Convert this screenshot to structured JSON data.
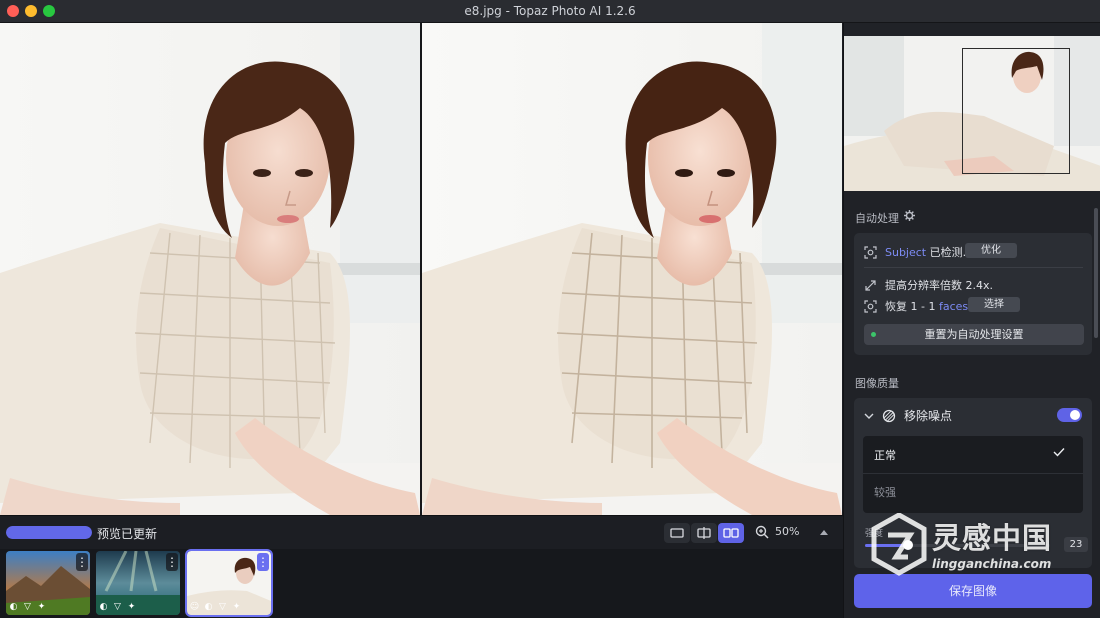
{
  "window": {
    "title": "e8.jpg - Topaz Photo AI 1.2.6"
  },
  "bottom_bar": {
    "preview_status": "预览已更新",
    "progress": 1.0,
    "zoom": "50%",
    "view_modes": [
      "single-view",
      "split-view",
      "side-by-side-view"
    ],
    "active_view": "side-by-side-view"
  },
  "filmstrip": {
    "thumbnails": [
      {
        "name": "mountain-landscape",
        "selected": false
      },
      {
        "name": "ocean-sunrays",
        "selected": false
      },
      {
        "name": "e8.jpg",
        "selected": true
      }
    ]
  },
  "sidebar": {
    "auto_section_label": "自动处理",
    "subject": {
      "word": "Subject",
      "text": "已检测.",
      "button": "优化"
    },
    "upscale": {
      "text": "提高分辨率倍数 2.4x."
    },
    "recover": {
      "prefix": "恢复 1 - 1",
      "link": "faces",
      "suffix": ".",
      "button": "选择"
    },
    "reset_button": "重置为自动处理设置",
    "quality_section_label": "图像质量",
    "denoise": {
      "title": "移除噪点",
      "enabled": true,
      "options": [
        "正常",
        "较强"
      ],
      "selected": "正常",
      "strength_label": "强度",
      "strength_value": "23",
      "strength_fraction": 0.23
    },
    "save_button": "保存图像"
  },
  "watermark": {
    "title": "灵感中国",
    "subtitle": "lingganchina.com"
  },
  "colors": {
    "accent": "#5e63ea",
    "link": "#7d8cf5",
    "panel": "#202227"
  }
}
